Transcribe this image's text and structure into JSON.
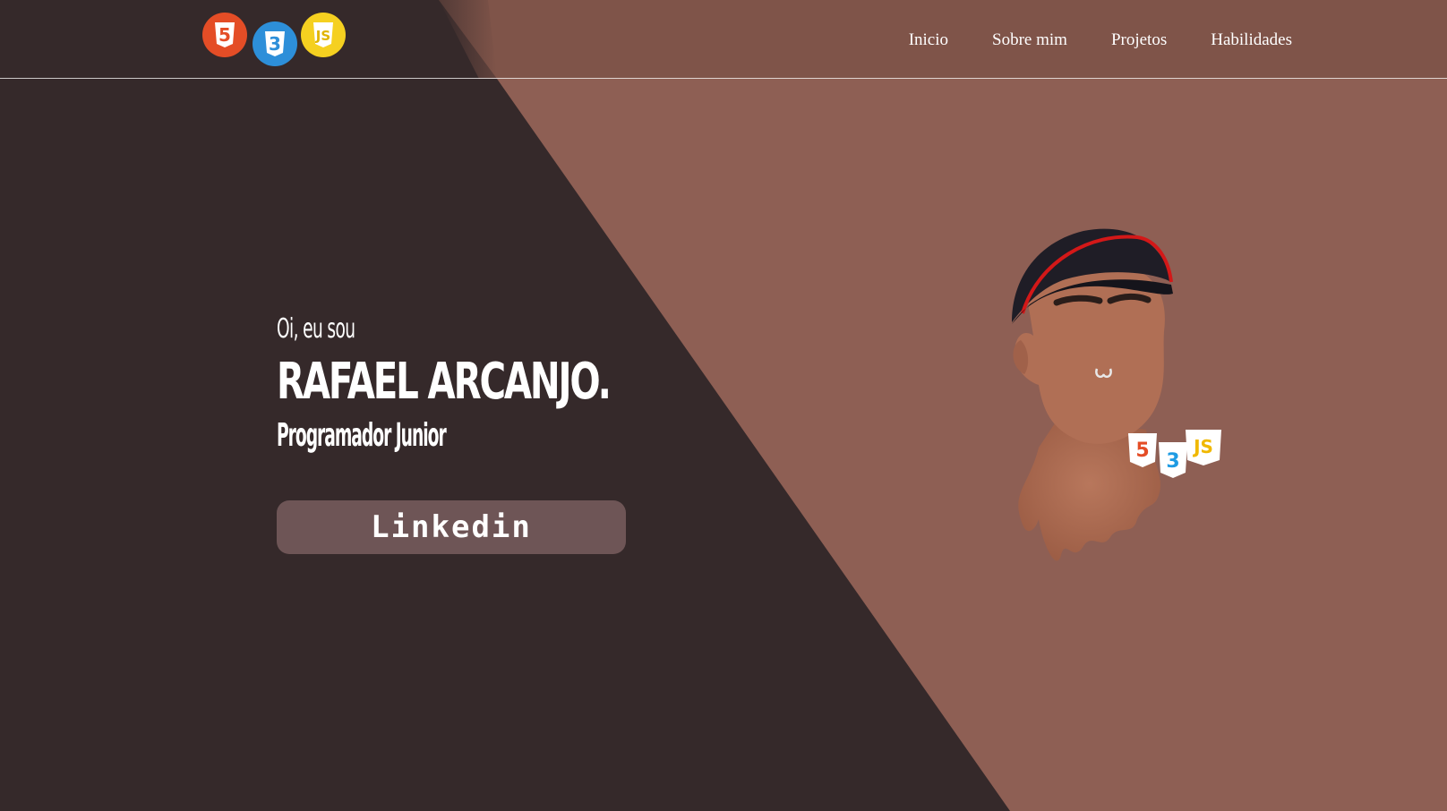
{
  "header": {
    "logos": [
      {
        "icon": "html5-logo-icon",
        "glyph": "5",
        "color": "#e44d26"
      },
      {
        "icon": "css3-logo-icon",
        "glyph": "3",
        "color": "#2965f1"
      },
      {
        "icon": "javascript-logo-icon",
        "glyph": "JS",
        "color": "#f0db4f"
      }
    ],
    "nav": [
      "Inicio",
      "Sobre mim",
      "Projetos",
      "Habilidades"
    ]
  },
  "hero": {
    "greeting": "Oi, eu sou",
    "name": "RAFAEL ARCANJO.",
    "role": "Programador Junior",
    "button_label": "Linkedin"
  },
  "colors": {
    "dark_bg": "#35292a",
    "accent_bg": "#8e5f54",
    "header_right_bg": "#7f5449",
    "button_bg": "#6e5556"
  },
  "avatar": {
    "icon": "avatar-illustration",
    "badges": [
      "5",
      "3",
      "JS"
    ]
  }
}
